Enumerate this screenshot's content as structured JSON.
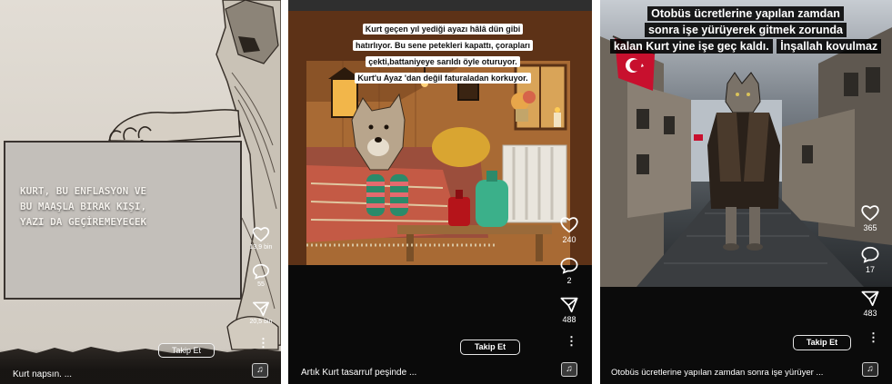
{
  "panel1": {
    "caption": "KURT, BU ENFLASYON VE\nBU MAAŞLA BIRAK KIŞI,\nYAZI DA GEÇİREMEYECEK",
    "likes": "13,9 bin",
    "comments": "55",
    "shares": "20,5 bin",
    "follow_label": "Takip Et",
    "description": "Kurt napsın. ...",
    "music_icon": "music-note-icon"
  },
  "panel2": {
    "caption_lines": [
      "Kurt geçen yıl yediği ayazı hâlâ dün gibi",
      "hatırlıyor. Bu sene petekleri  kapattı, çorapları",
      "çekti,battaniyeye sarıldı öyle oturuyor.",
      "Kurt'u Ayaz 'dan değil faturaladan korkuyor."
    ],
    "likes": "240",
    "comments": "2",
    "shares": "488",
    "follow_label": "Takip Et",
    "description": "Artık Kurt tasarruf peşinde ...",
    "music_icon": "music-note-icon"
  },
  "panel3": {
    "caption_lines": [
      "Otobüs ücretlerine yapılan zamdan",
      "sonra işe yürüyerek gitmek zorunda",
      "kalan Kurt yine işe geç kaldı.",
      "İnşallah kovulmaz"
    ],
    "likes": "365",
    "comments": "17",
    "shares": "483",
    "follow_label": "Takip Et",
    "description": "Otobüs ücretlerine yapılan zamdan sonra işe yürüyer ...",
    "music_icon": "music-note-icon"
  },
  "colors": {
    "panel1_bg": "#d9d4cc",
    "panel2_bg": "#0a0a0a",
    "panel3_bg": "#0b0b0b",
    "flag_red": "#c8102e"
  }
}
